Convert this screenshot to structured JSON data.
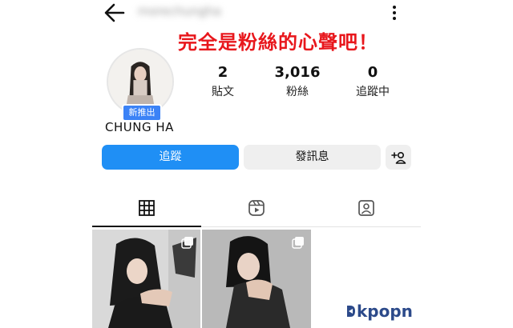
{
  "header": {
    "username": "morechungha",
    "back_icon": "arrow-left-icon",
    "more_icon": "more-vertical-icon"
  },
  "overlay_caption": "完全是粉絲的心聲吧！",
  "profile": {
    "display_name": "CHUNG HA",
    "badge": "新推出",
    "stats": [
      {
        "value": "2",
        "label": "貼文"
      },
      {
        "value": "3,016",
        "label": "粉絲"
      },
      {
        "value": "0",
        "label": "追蹤中"
      }
    ]
  },
  "actions": {
    "follow": "追蹤",
    "message": "發訊息",
    "add_user_icon": "person-add-icon"
  },
  "tabs": [
    {
      "icon": "grid-icon",
      "active": true
    },
    {
      "icon": "reels-icon",
      "active": false
    },
    {
      "icon": "tagged-user-icon",
      "active": false
    }
  ],
  "posts": [
    {
      "icon": "multi-photo-icon"
    },
    {
      "icon": "multi-photo-icon"
    }
  ],
  "watermark": "kpopn",
  "colors": {
    "primary_button": "#1f8ff5",
    "overlay_red": "#e8171c",
    "badge_blue": "#3b82f6",
    "watermark_blue": "#2c4a8a"
  }
}
